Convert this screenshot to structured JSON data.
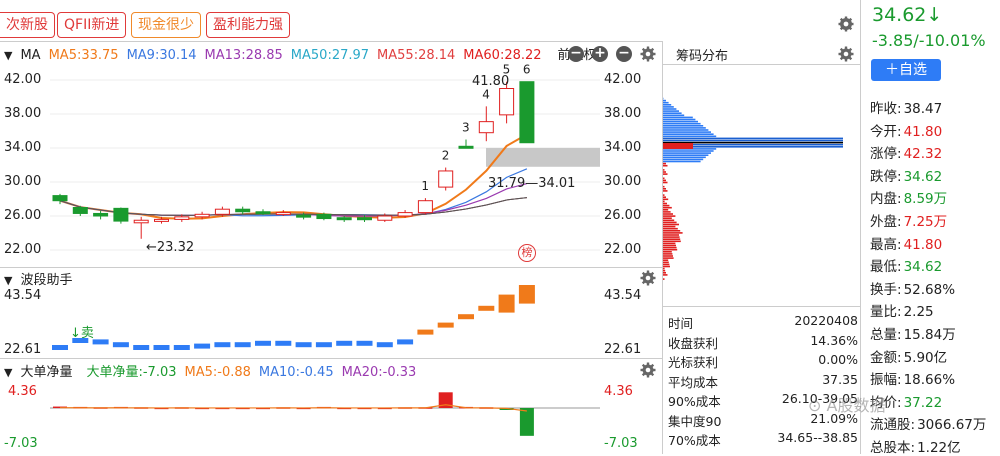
{
  "tabs": [
    {
      "label": "次新股",
      "color": "red"
    },
    {
      "label": "QFII新进",
      "color": "red"
    },
    {
      "label": "现金很少",
      "color": "orange"
    },
    {
      "label": "盈利能力强",
      "color": "red"
    }
  ],
  "quote": {
    "price": "34.62↓",
    "change": "-3.85/-10.01%",
    "add_watch": "＋自选"
  },
  "chart": {
    "ma_label": "MA",
    "ma": [
      {
        "text": "MA5:33.75",
        "color": "#f07a1a"
      },
      {
        "text": "MA9:30.14",
        "color": "#3a78e0"
      },
      {
        "text": "MA13:28.85",
        "color": "#9a3ab0"
      },
      {
        "text": "MA50:27.97",
        "color": "#2aa8c8"
      },
      {
        "text": "MA55:28.14",
        "color": "#e04040"
      },
      {
        "text": "MA60:28.22",
        "color": "#e02020"
      }
    ],
    "adjust": "前复权",
    "yticks": [
      "42.00",
      "38.00",
      "34.00",
      "30.00",
      "26.00",
      "22.00"
    ],
    "annot_high": "41.80",
    "annot_low": "←23.32",
    "annot_range": "31.79—34.01",
    "counts": [
      "1",
      "2",
      "3",
      "4",
      "5",
      "6"
    ],
    "bang": "榜"
  },
  "chart_data": {
    "type": "candlestick",
    "close": [
      27.8,
      26.3,
      26.0,
      25.4,
      25.5,
      25.6,
      25.9,
      26.2,
      26.8,
      26.5,
      26.4,
      26.4,
      26.0,
      25.7,
      25.6,
      25.7,
      26.0,
      26.4,
      27.8,
      31.3,
      34.0,
      37.1,
      41.0,
      34.62
    ],
    "open": [
      28.4,
      27.0,
      26.3,
      26.9,
      25.2,
      25.4,
      25.6,
      25.9,
      26.2,
      26.8,
      26.5,
      26.2,
      26.1,
      26.2,
      25.8,
      25.8,
      25.5,
      26.0,
      26.4,
      29.4,
      34.2,
      35.8,
      37.9,
      41.8
    ],
    "high": [
      28.6,
      27.2,
      26.6,
      27.0,
      25.9,
      25.9,
      26.2,
      26.5,
      27.1,
      27.1,
      26.8,
      26.7,
      26.4,
      26.4,
      26.0,
      26.1,
      26.3,
      26.7,
      28.1,
      31.7,
      35.0,
      38.9,
      41.8,
      41.8
    ],
    "low": [
      27.4,
      26.0,
      25.6,
      25.1,
      23.32,
      25.1,
      25.3,
      25.6,
      25.9,
      26.2,
      26.1,
      26.0,
      25.6,
      25.5,
      25.3,
      25.3,
      25.3,
      25.8,
      26.2,
      29.0,
      34.0,
      34.8,
      36.9,
      34.62
    ],
    "ylim": [
      22,
      42
    ],
    "wave": {
      "yticks": [
        "43.54",
        "22.61"
      ],
      "title": "波段助手",
      "signal": "↓卖"
    },
    "flow": {
      "yticks": [
        "4.36",
        "-7.03"
      ],
      "title": "大单净量",
      "items": [
        {
          "text": "大单净量:-7.03",
          "color": "#1a9a2e"
        },
        {
          "text": "MA5:-0.88",
          "color": "#f07a1a"
        },
        {
          "text": "MA10:-0.45",
          "color": "#3a78e0"
        },
        {
          "text": "MA20:-0.33",
          "color": "#9a3ab0"
        }
      ]
    }
  },
  "chips": {
    "title": "筹码分布",
    "rows": [
      {
        "k": "时间",
        "v": "20220408"
      },
      {
        "k": "收盘获利",
        "v": "14.36%"
      },
      {
        "k": "光标获利",
        "v": "0.00%"
      },
      {
        "k": "平均成本",
        "v": "37.35"
      },
      {
        "k": "90%成本",
        "v": "26.10-39.05"
      },
      {
        "k": "集中度90",
        "v": "21.09%"
      },
      {
        "k": "70%成本",
        "v": "34.65--38.85"
      }
    ]
  },
  "stats": [
    {
      "k": "昨收:",
      "v": "38.47",
      "c": ""
    },
    {
      "k": "今开:",
      "v": "41.80",
      "c": "red"
    },
    {
      "k": "涨停:",
      "v": "42.32",
      "c": "red"
    },
    {
      "k": "跌停:",
      "v": "34.62",
      "c": "grn"
    },
    {
      "k": "内盘:",
      "v": "8.59万",
      "c": "grn"
    },
    {
      "k": "外盘:",
      "v": "7.25万",
      "c": "red"
    },
    {
      "k": "最高:",
      "v": "41.80",
      "c": "red"
    },
    {
      "k": "最低:",
      "v": "34.62",
      "c": "grn"
    },
    {
      "k": "换手:",
      "v": "52.68%",
      "c": ""
    },
    {
      "k": "量比:",
      "v": "2.25",
      "c": ""
    },
    {
      "k": "总量:",
      "v": "15.84万",
      "c": ""
    },
    {
      "k": "金额:",
      "v": "5.90亿",
      "c": ""
    },
    {
      "k": "振幅:",
      "v": "18.66%",
      "c": ""
    },
    {
      "k": "均价:",
      "v": "37.22",
      "c": "grn"
    },
    {
      "k": "流通股:",
      "v": "3066.67万",
      "c": ""
    },
    {
      "k": "总股本:",
      "v": "1.22亿",
      "c": ""
    }
  ],
  "watermark": "A股数据"
}
